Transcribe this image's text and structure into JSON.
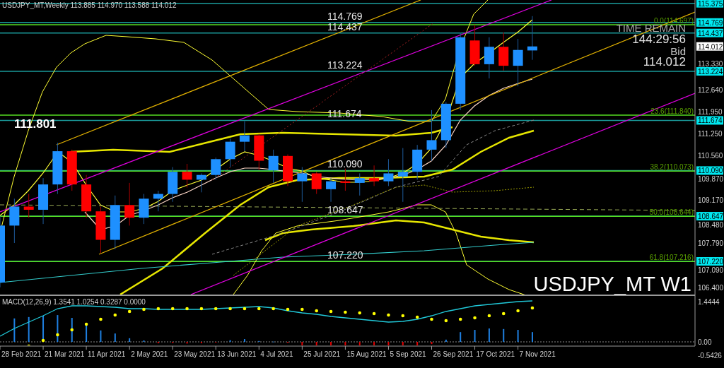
{
  "chart_header": "USDJPY_MT,Weekly  113.885 114.970 113.588 114.012",
  "symbol_label": "USDJPY_MT W1",
  "countdown": {
    "title": "TIME REMAIN",
    "time": "144:29:56",
    "bid_label": "Bid",
    "bid": "114.012"
  },
  "marker_label": "111.801",
  "level_lines": [
    "114.769",
    "114.437",
    "113.224",
    "111.674",
    "110.090",
    "108.647",
    "107.220"
  ],
  "fibonacci": [
    "0.0(114.697)",
    "23.6(111.840)",
    "38.2(110.073)",
    "50.0(108.644)",
    "61.8(107.216)"
  ],
  "price_axis": [
    {
      "label": "115.375",
      "kind": "level"
    },
    {
      "label": "114.769",
      "kind": "level"
    },
    {
      "label": "114.437",
      "kind": "level"
    },
    {
      "label": "114.012",
      "kind": "bid"
    },
    {
      "label": "113.330",
      "kind": "tick"
    },
    {
      "label": "113.224",
      "kind": "level"
    },
    {
      "label": "112.640",
      "kind": "tick"
    },
    {
      "label": "111.950",
      "kind": "tick"
    },
    {
      "label": "111.674",
      "kind": "level"
    },
    {
      "label": "111.250",
      "kind": "tick"
    },
    {
      "label": "110.560",
      "kind": "tick"
    },
    {
      "label": "110.090",
      "kind": "level"
    },
    {
      "label": "109.870",
      "kind": "tick"
    },
    {
      "label": "109.170",
      "kind": "tick"
    },
    {
      "label": "108.647",
      "kind": "level"
    },
    {
      "label": "108.480",
      "kind": "tick"
    },
    {
      "label": "107.790",
      "kind": "tick"
    },
    {
      "label": "107.220",
      "kind": "level"
    },
    {
      "label": "107.090",
      "kind": "tick"
    },
    {
      "label": "106.400",
      "kind": "tick"
    }
  ],
  "macd": {
    "title": "MACD(12,26,9) 1.3541 1.0254 0.3287 0.0000",
    "axis": [
      "1.4444",
      "0.00",
      "-0.5426"
    ]
  },
  "time_axis": [
    "28 Feb 2021",
    "21 Mar 2021",
    "11 Apr 2021",
    "2 May 2021",
    "23 May 2021",
    "13 Jun 2021",
    "4 Jul 2021",
    "25 Jul 2021",
    "15 Aug 2021",
    "5 Sep 2021",
    "26 Sep 2021",
    "17 Oct 2021",
    "7 Nov 2021"
  ]
}
